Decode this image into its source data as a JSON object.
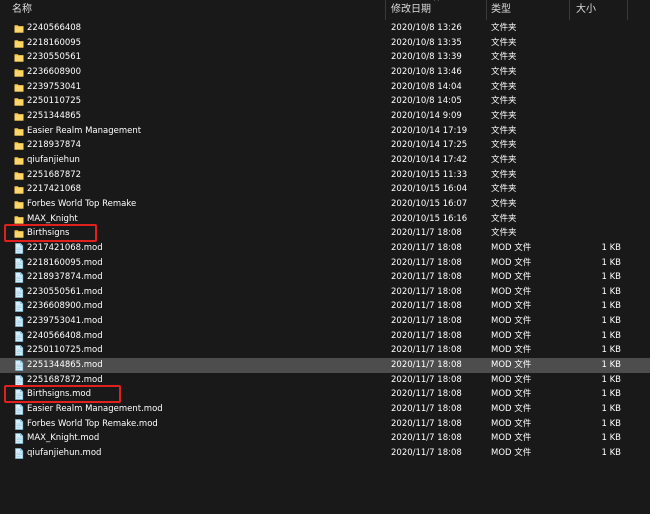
{
  "columns": {
    "name": "名称",
    "date": "修改日期",
    "type": "类型",
    "size": "大小"
  },
  "rows": [
    {
      "name": "2240566408",
      "date": "2020/10/8 13:26",
      "type": "文件夹",
      "size": "",
      "icon": "folder-icon"
    },
    {
      "name": "2218160095",
      "date": "2020/10/8 13:35",
      "type": "文件夹",
      "size": "",
      "icon": "folder-icon"
    },
    {
      "name": "2230550561",
      "date": "2020/10/8 13:39",
      "type": "文件夹",
      "size": "",
      "icon": "folder-icon"
    },
    {
      "name": "2236608900",
      "date": "2020/10/8 13:46",
      "type": "文件夹",
      "size": "",
      "icon": "folder-icon"
    },
    {
      "name": "2239753041",
      "date": "2020/10/8 14:04",
      "type": "文件夹",
      "size": "",
      "icon": "folder-icon"
    },
    {
      "name": "2250110725",
      "date": "2020/10/8 14:05",
      "type": "文件夹",
      "size": "",
      "icon": "folder-icon"
    },
    {
      "name": "2251344865",
      "date": "2020/10/14 9:09",
      "type": "文件夹",
      "size": "",
      "icon": "folder-icon"
    },
    {
      "name": "Easier Realm Management",
      "date": "2020/10/14 17:19",
      "type": "文件夹",
      "size": "",
      "icon": "folder-icon"
    },
    {
      "name": "2218937874",
      "date": "2020/10/14 17:25",
      "type": "文件夹",
      "size": "",
      "icon": "folder-icon"
    },
    {
      "name": "qiufanjiehun",
      "date": "2020/10/14 17:42",
      "type": "文件夹",
      "size": "",
      "icon": "folder-icon"
    },
    {
      "name": "2251687872",
      "date": "2020/10/15 11:33",
      "type": "文件夹",
      "size": "",
      "icon": "folder-icon"
    },
    {
      "name": "2217421068",
      "date": "2020/10/15 16:04",
      "type": "文件夹",
      "size": "",
      "icon": "folder-icon"
    },
    {
      "name": "Forbes World Top Remake",
      "date": "2020/10/15 16:07",
      "type": "文件夹",
      "size": "",
      "icon": "folder-icon"
    },
    {
      "name": "MAX_Knight",
      "date": "2020/10/15 16:16",
      "type": "文件夹",
      "size": "",
      "icon": "folder-icon"
    },
    {
      "name": "Birthsigns",
      "date": "2020/11/7 18:08",
      "type": "文件夹",
      "size": "",
      "icon": "folder-icon",
      "highlight": true
    },
    {
      "name": "2217421068.mod",
      "date": "2020/11/7 18:08",
      "type": "MOD 文件",
      "size": "1 KB",
      "icon": "mod-file-icon"
    },
    {
      "name": "2218160095.mod",
      "date": "2020/11/7 18:08",
      "type": "MOD 文件",
      "size": "1 KB",
      "icon": "mod-file-icon"
    },
    {
      "name": "2218937874.mod",
      "date": "2020/11/7 18:08",
      "type": "MOD 文件",
      "size": "1 KB",
      "icon": "mod-file-icon"
    },
    {
      "name": "2230550561.mod",
      "date": "2020/11/7 18:08",
      "type": "MOD 文件",
      "size": "1 KB",
      "icon": "mod-file-icon"
    },
    {
      "name": "2236608900.mod",
      "date": "2020/11/7 18:08",
      "type": "MOD 文件",
      "size": "1 KB",
      "icon": "mod-file-icon"
    },
    {
      "name": "2239753041.mod",
      "date": "2020/11/7 18:08",
      "type": "MOD 文件",
      "size": "1 KB",
      "icon": "mod-file-icon"
    },
    {
      "name": "2240566408.mod",
      "date": "2020/11/7 18:08",
      "type": "MOD 文件",
      "size": "1 KB",
      "icon": "mod-file-icon"
    },
    {
      "name": "2250110725.mod",
      "date": "2020/11/7 18:08",
      "type": "MOD 文件",
      "size": "1 KB",
      "icon": "mod-file-icon"
    },
    {
      "name": "2251344865.mod",
      "date": "2020/11/7 18:08",
      "type": "MOD 文件",
      "size": "1 KB",
      "icon": "mod-file-icon",
      "selected": true
    },
    {
      "name": "2251687872.mod",
      "date": "2020/11/7 18:08",
      "type": "MOD 文件",
      "size": "1 KB",
      "icon": "mod-file-icon"
    },
    {
      "name": "Birthsigns.mod",
      "date": "2020/11/7 18:08",
      "type": "MOD 文件",
      "size": "1 KB",
      "icon": "mod-file-icon",
      "highlight": true
    },
    {
      "name": "Easier Realm Management.mod",
      "date": "2020/11/7 18:08",
      "type": "MOD 文件",
      "size": "1 KB",
      "icon": "mod-file-icon"
    },
    {
      "name": "Forbes World Top Remake.mod",
      "date": "2020/11/7 18:08",
      "type": "MOD 文件",
      "size": "1 KB",
      "icon": "mod-file-icon"
    },
    {
      "name": "MAX_Knight.mod",
      "date": "2020/11/7 18:08",
      "type": "MOD 文件",
      "size": "1 KB",
      "icon": "mod-file-icon"
    },
    {
      "name": "qiufanjiehun.mod",
      "date": "2020/11/7 18:08",
      "type": "MOD 文件",
      "size": "1 KB",
      "icon": "mod-file-icon"
    }
  ],
  "colors": {
    "background": "#191919",
    "selected_row": "#4d4d4d",
    "highlight_box": "#e0201c",
    "folder": "#f8c94a",
    "mod_file": "#9fd0ea"
  }
}
